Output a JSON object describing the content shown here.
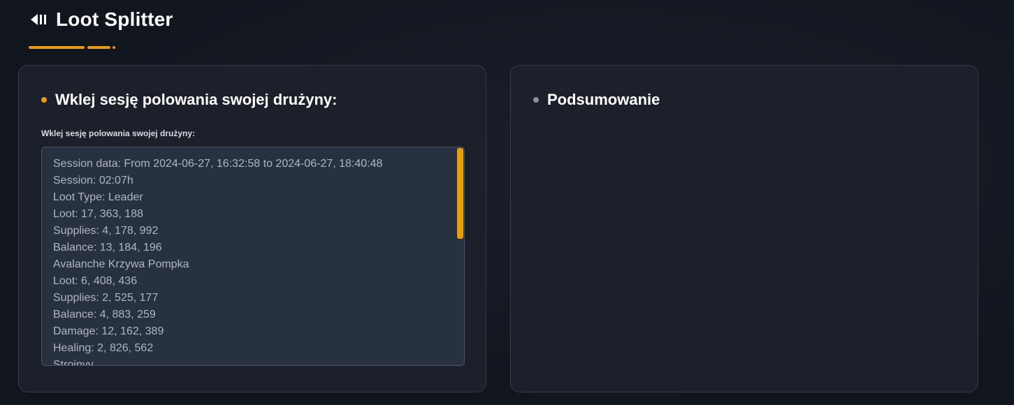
{
  "header": {
    "title": "Loot Splitter",
    "back_icon": "back-play-icon"
  },
  "colors": {
    "accent": "#e69b1b",
    "muted_bullet": "#8a909b",
    "background": "#11151e",
    "card": "#1b202b",
    "textarea": "#283140"
  },
  "left_panel": {
    "title": "Wklej sesję polowania swojej drużyny:",
    "field_label": "Wklej sesję polowania swojej drużyny:",
    "session_lines": [
      "Session data: From 2024-06-27, 16:32:58 to 2024-06-27, 18:40:48",
      "Session: 02:07h",
      "Loot Type: Leader",
      "Loot: 17, 363, 188",
      "Supplies: 4, 178, 992",
      "Balance: 13, 184, 196",
      "Avalanche Krzywa Pompka",
      "Loot: 6, 408, 436",
      "Supplies: 2, 525, 177",
      "Balance: 4, 883, 259",
      "Damage: 12, 162, 389",
      "Healing: 2, 826, 562",
      "Strojnyy"
    ]
  },
  "right_panel": {
    "title": "Podsumowanie"
  }
}
